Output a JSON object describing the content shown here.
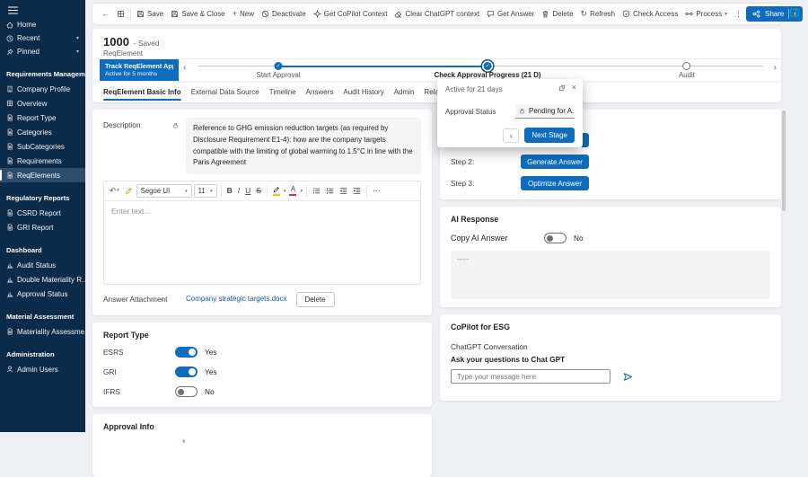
{
  "colors": {
    "accent": "#0f6cbd",
    "sidebar_bg": "#0b2b4a",
    "sidebar_selected": "#2d4d6d",
    "copilot_teal": "#1b9aaa",
    "link": "#115ea3",
    "required_red": "#d13438"
  },
  "icons": {
    "back": "←",
    "plus": "+",
    "refresh": "↻",
    "more_v": "⋮",
    "more_h": "⋯",
    "chevron_down": "▾",
    "chevron_left": "‹",
    "chevron_right": "›",
    "close": "×",
    "check": "✓",
    "undo": "↶"
  },
  "sidebar": {
    "top_items": [
      {
        "label": "Home"
      },
      {
        "label": "Recent"
      },
      {
        "label": "Pinned"
      }
    ],
    "groups": [
      {
        "label": "Requirements Management",
        "items": [
          {
            "label": "Company Profile"
          },
          {
            "label": "Overview"
          },
          {
            "label": "Report Type"
          },
          {
            "label": "Categories"
          },
          {
            "label": "SubCategories"
          },
          {
            "label": "Requirements"
          },
          {
            "label": "ReqElements"
          }
        ]
      },
      {
        "label": "Regulatory Reports",
        "items": [
          {
            "label": "CSRD Report"
          },
          {
            "label": "GRI Report"
          }
        ]
      },
      {
        "label": "Dashboard",
        "items": [
          {
            "label": "Audit Status"
          },
          {
            "label": "Double Materiality R..."
          },
          {
            "label": "Approval Status"
          }
        ]
      },
      {
        "label": "Material Assessment",
        "items": [
          {
            "label": "Materiality Assessme..."
          }
        ]
      },
      {
        "label": "Administration",
        "items": [
          {
            "label": "Admin Users"
          }
        ]
      }
    ],
    "selected_item": "ReqElements"
  },
  "command_bar": {
    "save": "Save",
    "save_close": "Save & Close",
    "new": "New",
    "deactivate": "Deactivate",
    "copilot_context": "Get CoPilot Context",
    "clear_chatgpt": "Clear ChatGPT context",
    "get_answer": "Get Answer",
    "delete": "Delete",
    "refresh": "Refresh",
    "check_access": "Check Access",
    "process": "Process",
    "share": "Share"
  },
  "header": {
    "record_id": "1000",
    "status_text": "- Saved",
    "entity_label": "ReqElement",
    "badge_title": "Track ReqElement Appro...",
    "badge_subtitle": "Active for 5 months",
    "stages": [
      {
        "label": "Start Approval",
        "state": "done"
      },
      {
        "label": "Check Approval Progress (21 D)",
        "state": "active"
      },
      {
        "label": "Audit",
        "state": "todo"
      }
    ]
  },
  "flyout": {
    "active_text": "Active for 21 days",
    "field_label": "Approval Status",
    "field_value": "Pending for A...",
    "next_stage_label": "Next Stage"
  },
  "tabs": [
    {
      "label": "ReqElement Basic Info",
      "active": true
    },
    {
      "label": "External Data Source"
    },
    {
      "label": "Timeline"
    },
    {
      "label": "Answers"
    },
    {
      "label": "Audit History"
    },
    {
      "label": "Admin"
    },
    {
      "label": "Related"
    }
  ],
  "basic_info": {
    "description_label": "Description",
    "description_value": "Reference to GHG emission reduction targets (as required by Disclosure Requirement E1-4): how are the company targets compatible with the limiting of global warming to 1.5°C in line with the Paris Agreement",
    "editor": {
      "font_name": "Segoe UI",
      "font_size": "11",
      "placeholder": "Enter text..."
    },
    "attachment_label": "Answer Attachment",
    "attachment_file": "Company strategic targets.docx",
    "delete_label": "Delete"
  },
  "report_type": {
    "title": "Report Type",
    "rows": [
      {
        "label": "ESRS",
        "value": "Yes",
        "on": true
      },
      {
        "label": "GRI",
        "value": "Yes",
        "on": true
      },
      {
        "label": "IFRS",
        "value": "No",
        "on": false
      }
    ]
  },
  "approval_info": {
    "title": "Approval Info",
    "required_marker": "*"
  },
  "answer_steps": {
    "rows": [
      {
        "label": "Step 2:",
        "button": "Generate Answer"
      },
      {
        "label": "Step 3:",
        "button": "Optimize Answer"
      }
    ]
  },
  "ai_response": {
    "title": "AI Response",
    "copy_label": "Copy AI Answer",
    "copy_value": "No",
    "copy_on": false,
    "box_text": "-----"
  },
  "copilot": {
    "title": "CoPilot for ESG",
    "conversation_label": "ChatGPT Conversation",
    "ask_label": "Ask your questions to Chat GPT",
    "input_placeholder": "Type your message here"
  }
}
